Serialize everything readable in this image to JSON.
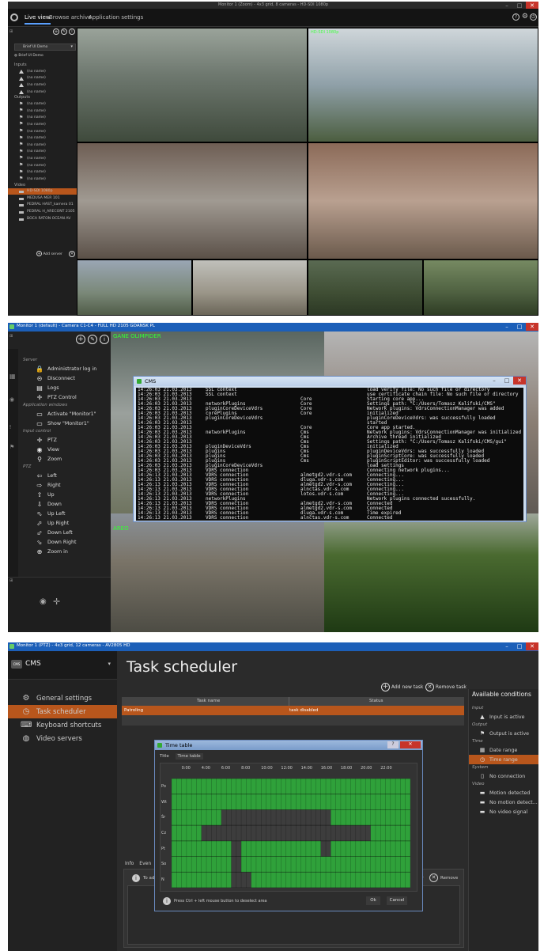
{
  "s1": {
    "title": "Monitor 1 (Zoom) - 4x3 grid, 8 cameras - HD-SDI 1080p",
    "tabs": [
      "Live view",
      "Browse archive",
      "Application settings"
    ],
    "select_top": "Brief UI Demo",
    "tree_root": "Brief UI Demo",
    "hdr_inputs": "Inputs",
    "inputs": [
      "(no name)",
      "(no name)",
      "(no name)",
      "(no name)"
    ],
    "hdr_outputs": "Outputs",
    "outputs": [
      "(no name)",
      "(no name)",
      "(no name)",
      "(no name)",
      "(no name)",
      "(no name)",
      "(no name)",
      "(no name)",
      "(no name)",
      "(no name)",
      "(no name)",
      "(no name)"
    ],
    "hdr_video": "Video",
    "video": [
      "HD-SDI 1080p",
      "MEDUSA MER 101",
      "PEDRAL HAST_kamera 01",
      "PEDRAL H_ARECONT 2105",
      "BOCA RATON OCEAN AV"
    ],
    "add_server": "Add server",
    "cams": [
      {
        "label": "",
        "bg": "#8a8f86"
      },
      {
        "label": "HD-SDI 1080p",
        "bg": "#9aa4a8"
      },
      {
        "label": "",
        "bg": "#7e6d60"
      },
      {
        "label": "",
        "bg": "#8b6a58"
      },
      {
        "label": "",
        "bg": "#8d8f9a"
      },
      {
        "label": "",
        "bg": "#a39d90"
      },
      {
        "label": "",
        "bg": "#4d5a42"
      },
      {
        "label": "",
        "bg": "#5c6f4c"
      }
    ]
  },
  "s2": {
    "title": "Monitor 1 (default) - Camera C1-C4 - FULL HD 2105 GDANSK PL",
    "left_header": "Server",
    "server_items": [
      {
        "label": "Administrator log in",
        "icon": "lock-icon",
        "g": "🔒"
      },
      {
        "label": "Disconnect",
        "icon": "disconnect-icon",
        "g": "⊝"
      },
      {
        "label": "Logs",
        "icon": "logs-icon",
        "g": "▤"
      },
      {
        "label": "PTZ Control",
        "icon": "ptz-icon",
        "g": "✛"
      }
    ],
    "app_header": "Application windows",
    "app_items": [
      {
        "label": "Activate \"Monitor1\"",
        "icon": "monitor-icon",
        "g": "▭"
      },
      {
        "label": "Show \"Monitor1\"",
        "icon": "monitor-icon",
        "g": "▭"
      }
    ],
    "input_header": "Input control",
    "input_items": [
      {
        "label": "PTZ",
        "icon": "move-icon",
        "g": "✛"
      },
      {
        "label": "View",
        "icon": "eye-icon",
        "g": "◉"
      },
      {
        "label": "Zoom",
        "icon": "magnifier-icon",
        "g": "⚲"
      }
    ],
    "ptz_header": "PTZ",
    "ptz_items": [
      {
        "label": "Left",
        "icon": "arrow-left-icon",
        "g": "⇦"
      },
      {
        "label": "Right",
        "icon": "arrow-right-icon",
        "g": "⇨"
      },
      {
        "label": "Up",
        "icon": "arrow-up-icon",
        "g": "⇧"
      },
      {
        "label": "Down",
        "icon": "arrow-down-icon",
        "g": "⇩"
      },
      {
        "label": "Up Left",
        "icon": "arrow-up-left-icon",
        "g": "⬁"
      },
      {
        "label": "Up Right",
        "icon": "arrow-up-right-icon",
        "g": "⬀"
      },
      {
        "label": "Down Left",
        "icon": "arrow-down-left-icon",
        "g": "⬃"
      },
      {
        "label": "Down Right",
        "icon": "arrow-down-right-icon",
        "g": "⬂"
      },
      {
        "label": "Zoom in",
        "icon": "zoom-in-icon",
        "g": "⊕"
      }
    ],
    "cam_labels": [
      "GANE OLIMPIDER",
      "",
      "",
      "AREO"
    ],
    "console_title": "CMS",
    "console": [
      [
        "14:26:03 21.03.2013",
        "SSL context",
        "",
        "load verify file: No such file or directory"
      ],
      [
        "14:26:03 21.03.2013",
        "SSL context",
        "",
        "use certificate chain file: No such file or directory"
      ],
      [
        "14:26:03 21.03.2013",
        "",
        "Core",
        "Starting core app..."
      ],
      [
        "14:26:03 21.03.2013",
        "networkPlugins",
        "Core",
        "Settings path: \"C:/Users/Tomasz Kalifski/CMS\""
      ],
      [
        "14:26:03 21.03.2013",
        "pluginCoreDeviceVdrs",
        "Core",
        "Network plugins: VdrsConnectionManager was added"
      ],
      [
        "14:26:03 21.03.2013",
        "corePlugins",
        "Core",
        "initialized"
      ],
      [
        "14:26:03 21.03.2013",
        "pluginCoreDeviceVdrs",
        "",
        "pluginCoreDeviceVdrs: was successfully loaded"
      ],
      [
        "14:26:03 21.03.2013",
        "",
        "",
        "started"
      ],
      [
        "14:26:03 21.03.2013",
        "",
        "Core",
        "Core app started."
      ],
      [
        "14:26:03 21.03.2013",
        "networkPlugins",
        "Cms",
        "Network plugins: VdrsConnectionManager was initialized"
      ],
      [
        "14:26:03 21.03.2013",
        "",
        "Cms",
        "Archive thread initialized"
      ],
      [
        "14:26:03 21.03.2013",
        "",
        "Cms",
        "Settings path: \"C:/Users/Tomasz Kalifski/CMS/gui\""
      ],
      [
        "14:26:03 21.03.2013",
        "pluginDeviceVdrs",
        "Cms",
        "initialized"
      ],
      [
        "14:26:03 21.03.2013",
        "plugins",
        "Cms",
        "pluginDeviceVdrs: was successfully loaded"
      ],
      [
        "14:26:03 21.03.2013",
        "plugins",
        "Cms",
        "pluginScriptCore: was successfully loaded"
      ],
      [
        "14:26:03 21.03.2013",
        "plugins",
        "Cms",
        "pluginScriptEditor: was successfully loaded"
      ],
      [
        "14:26:03 21.03.2013",
        "pluginCoreDeviceVdrs",
        "",
        "load settings"
      ],
      [
        "14:26:03 21.03.2013",
        "VDRS connection",
        "",
        "Connecting network plugins..."
      ],
      [
        "14:26:13 21.03.2013",
        "VDRS connection",
        "almetgd2.vdr-s.com",
        "Connecting..."
      ],
      [
        "14:26:13 21.03.2013",
        "VDRS connection",
        "dluga.vdr-s.com",
        "Connecting..."
      ],
      [
        "14:26:13 21.03.2013",
        "VDRS connection",
        "almetgd2.vdr-s.com",
        "Connecting..."
      ],
      [
        "14:26:13 21.03.2013",
        "VDRS connection",
        "alnctas.vdr-s.com",
        "Connecting..."
      ],
      [
        "14:26:13 21.03.2013",
        "VDRS connection",
        "lotos.vdr-s.com",
        "Connecting..."
      ],
      [
        "14:26:13 21.03.2013",
        "networkPlugins",
        "",
        "Network plugins connected sucessfully."
      ],
      [
        "14:26:13 21.03.2013",
        "VDRS connection",
        "almetgd2.vdr-s.com",
        "Connected"
      ],
      [
        "14:26:13 21.03.2013",
        "VDRS connection",
        "almetgd2.vdr-s.com",
        "Connected"
      ],
      [
        "14:26:13 21.03.2013",
        "VDRS connection",
        "dluga.vdr-s.com",
        "Time expired"
      ],
      [
        "14:26:13 21.03.2013",
        "VDRS connection",
        "alnctas.vdr-s.com",
        "Connected"
      ]
    ]
  },
  "s3": {
    "title": "Monitor 1 (PTZ) - 4x3 grid, 12 cameras - AV2805 HD",
    "app": "CMS",
    "heading": "Task scheduler",
    "nav": [
      {
        "label": "General settings",
        "icon": "gear-icon",
        "g": "⚙"
      },
      {
        "label": "Task scheduler",
        "icon": "clock-icon",
        "g": "◷"
      },
      {
        "label": "Keyboard shortcuts",
        "icon": "keyboard-icon",
        "g": "⌨"
      },
      {
        "label": "Video servers",
        "icon": "globe-icon",
        "g": "◍"
      }
    ],
    "add_task": "Add new task",
    "remove_task": "Remove task",
    "col_name": "Task name",
    "col_status": "Status",
    "task_name": "Patroling",
    "task_status": "task disabled",
    "tabs_lower": [
      "Info",
      "Even"
    ],
    "lower_add": "To add",
    "lower_modify": "ify",
    "lower_remove": "Remove",
    "avail_title": "Available conditions",
    "avail": [
      {
        "h": "Input",
        "items": [
          {
            "label": "Input is active",
            "icon": "input-icon",
            "g": "▲"
          }
        ]
      },
      {
        "h": "Output",
        "items": [
          {
            "label": "Output is active",
            "icon": "output-icon",
            "g": "⚑"
          }
        ]
      },
      {
        "h": "Time",
        "items": [
          {
            "label": "Date range",
            "icon": "calendar-icon",
            "g": "▦"
          },
          {
            "label": "Time range",
            "icon": "time-range-icon",
            "g": "◷",
            "sel": true
          }
        ]
      },
      {
        "h": "System",
        "items": [
          {
            "label": "No connection",
            "icon": "no-connection-icon",
            "g": "▯"
          }
        ]
      },
      {
        "h": "Video",
        "items": [
          {
            "label": "Motion detected",
            "icon": "camera-icon",
            "g": "▬"
          },
          {
            "label": "No motion detect...",
            "icon": "camera-icon",
            "g": "▬"
          },
          {
            "label": "No video signal",
            "icon": "camera-icon",
            "g": "▬"
          }
        ]
      }
    ],
    "dlg_title": "Time table",
    "dlg_tab1": "Title",
    "dlg_tab2": "Time table",
    "hours": [
      "0:00",
      "4:00",
      "6:00",
      "8:00",
      "10:00",
      "12:00",
      "14:00",
      "16:00",
      "18:00",
      "20:00",
      "22:00"
    ],
    "days": [
      "Po",
      "Wt",
      "Śr",
      "Cz",
      "Pt",
      "So",
      "N"
    ],
    "hint": "Press Ctrl + left mouse button to deselect area",
    "ok": "Ok",
    "cancel": "Cancel",
    "schedule": [
      [
        [
          0,
          24
        ]
      ],
      [
        [
          0,
          24
        ]
      ],
      [
        [
          0,
          5
        ],
        [
          16,
          24
        ]
      ],
      [
        [
          0,
          3
        ],
        [
          20,
          24
        ]
      ],
      [
        [
          0,
          6
        ],
        [
          7,
          15
        ],
        [
          16,
          24
        ]
      ],
      [
        [
          0,
          6
        ],
        [
          7,
          24
        ]
      ],
      [
        [
          0,
          6
        ],
        [
          8,
          24
        ]
      ]
    ],
    "green": "#2fa13a",
    "accent": "#b8561c"
  }
}
